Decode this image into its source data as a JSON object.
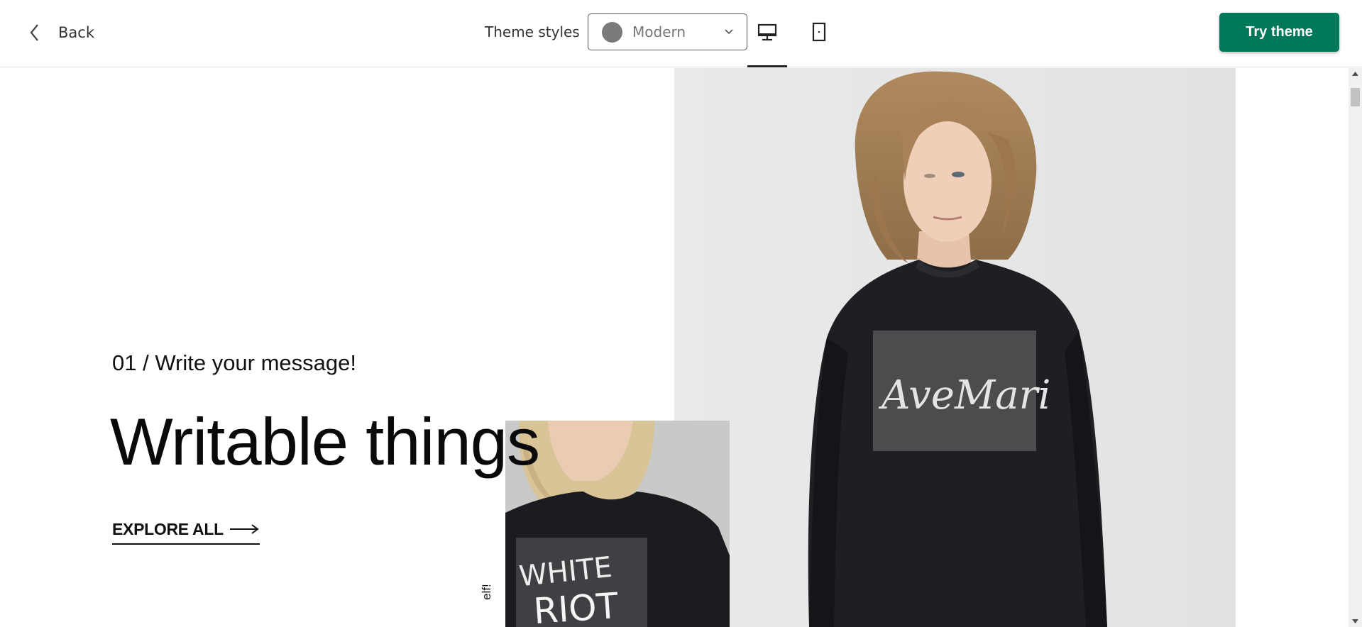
{
  "header": {
    "back_label": "Back",
    "theme_styles_label": "Theme styles",
    "style_select": {
      "value": "Modern",
      "swatch_color": "#7a7a7a"
    },
    "devices": [
      {
        "name": "desktop",
        "icon": "desktop-icon",
        "selected": true
      },
      {
        "name": "mobile",
        "icon": "mobile-icon",
        "selected": false
      }
    ],
    "try_theme_label": "Try theme",
    "accent_color": "#00785a"
  },
  "hero": {
    "kicker": "01 / Write your message!",
    "headline": "Writable things",
    "explore_label": "EXPLORE ALL",
    "vertical_text": "elf!",
    "main_image": {
      "subject": "model in black sweatshirt",
      "print_text": "AveMari"
    },
    "secondary_image": {
      "subject": "model in black t-shirt",
      "print_text": "WHITE RIOT"
    }
  }
}
